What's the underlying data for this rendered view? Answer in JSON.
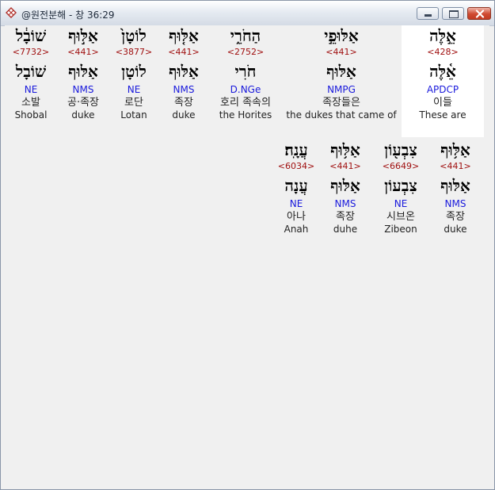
{
  "window": {
    "title": "@원전분해 - 창 36:29"
  },
  "rows": [
    {
      "words": [
        {
          "hebrew": "אֵ֣לֶּה",
          "strong": "<428>",
          "lemma": "אֵ֫לֶּה",
          "pos": "APDCP",
          "korean": "이들",
          "english": "These are",
          "highlight": true
        },
        {
          "hebrew": "אַלּוּפֵ֣י",
          "strong": "<441>",
          "lemma": "אַלּוּף",
          "pos": "NMPG",
          "korean": "족장들은",
          "english": "the dukes that came of",
          "highlight": false
        },
        {
          "hebrew": "הַחֹרִ֑י",
          "strong": "<2752>",
          "lemma": "חֹרִי",
          "pos": "D.NGe",
          "korean": "호리 족속의",
          "english": "the Horites",
          "highlight": false
        },
        {
          "hebrew": "אַלּ֤וּף",
          "strong": "<441>",
          "lemma": "אַלּוּף",
          "pos": "NMS",
          "korean": "족장",
          "english": "duke",
          "highlight": false
        },
        {
          "hebrew": "לוֹטָן֙",
          "strong": "<3877>",
          "lemma": "לוֹטָן",
          "pos": "NE",
          "korean": "로단",
          "english": "Lotan",
          "highlight": false
        },
        {
          "hebrew": "אַלּ֣וּף",
          "strong": "<441>",
          "lemma": "אַלּוּף",
          "pos": "NMS",
          "korean": "공·족장",
          "english": "duke",
          "highlight": false
        },
        {
          "hebrew": "שׁוֹבָ֔ל",
          "strong": "<7732>",
          "lemma": "שׁוֹבָל",
          "pos": "NE",
          "korean": "소발",
          "english": "Shobal",
          "highlight": false
        }
      ]
    },
    {
      "words": [
        {
          "hebrew": "אַלּ֥וּף",
          "strong": "<441>",
          "lemma": "אַלּוּף",
          "pos": "NMS",
          "korean": "족장",
          "english": "duke"
        },
        {
          "hebrew": "צִבְע֖וֹן",
          "strong": "<6649>",
          "lemma": "צִבְעוֹן",
          "pos": "NE",
          "korean": "시브온",
          "english": "Zibeon"
        },
        {
          "hebrew": "אַלּ֥וּף",
          "strong": "<441>",
          "lemma": "אַלּוּף",
          "pos": "NMS",
          "korean": "족장",
          "english": "duhe"
        },
        {
          "hebrew": "עֲנָֽה׃",
          "strong": "<6034>",
          "lemma": "עֲנָה",
          "pos": "NE",
          "korean": "아나",
          "english": "Anah"
        }
      ]
    }
  ]
}
